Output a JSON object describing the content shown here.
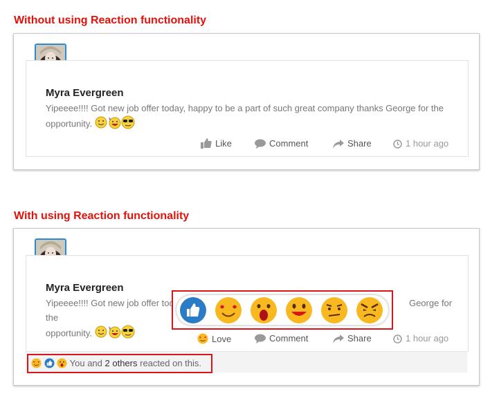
{
  "sections": {
    "without_title": "Without using Reaction functionality",
    "with_title": "With using Reaction functionality"
  },
  "post": {
    "author": "Myra Evergreen",
    "text": "Yipeeee!!!! Got new job offer today, happy to be a part of such great company thanks George for the opportunity.",
    "text_line1": "Yipeeee!!!! Got new job offer today, happy to be a part of such great company thanks George for the",
    "text_line1_short": "Yipeeee!!!! Got new job offer toda",
    "text_line1_tail": "George for the",
    "text_line2": "opportunity.",
    "emojis": [
      "smile-emoji",
      "party-emoji",
      "sunglasses-emoji"
    ]
  },
  "actions_before": {
    "like": "Like",
    "comment": "Comment",
    "share": "Share",
    "time": "1 hour ago"
  },
  "actions_after": {
    "love": "Love",
    "comment": "Comment",
    "share": "Share",
    "time": "1 hour ago"
  },
  "reactions": [
    "like",
    "love",
    "wow",
    "haha",
    "sad",
    "angry"
  ],
  "summary": {
    "prefix": "You and",
    "count": "2 others",
    "suffix": "reacted on this."
  },
  "colors": {
    "accent_red": "#e2120b",
    "highlight_red": "#d9151b",
    "avatar_border": "#2a8bd0",
    "like_blue": "#2b7bc6",
    "emoji_yellow": "#f7b820"
  }
}
